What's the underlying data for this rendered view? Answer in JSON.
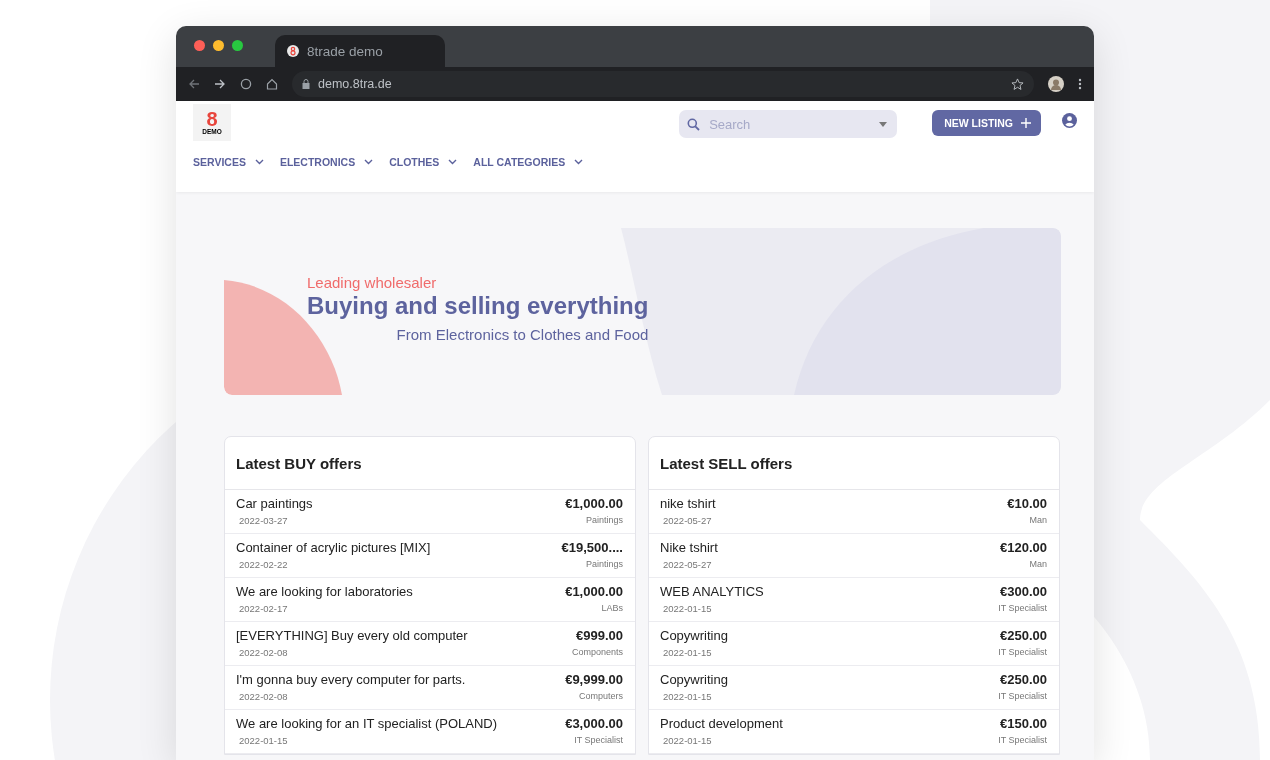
{
  "browser": {
    "tab_title": "8trade demo",
    "url": "demo.8tra.de"
  },
  "header": {
    "logo_mark": "8",
    "logo_text": "DEMO",
    "search": {
      "placeholder": "Search"
    },
    "new_listing_button": "NEW LISTING",
    "nav": [
      {
        "label": "SERVICES"
      },
      {
        "label": "ELECTRONICS"
      },
      {
        "label": "CLOTHES"
      },
      {
        "label": "ALL CATEGORIES"
      }
    ]
  },
  "hero": {
    "eyebrow": "Leading wholesaler",
    "title": "Buying and selling everything",
    "subtitle": "From Electronics to Clothes and Food"
  },
  "panels": [
    {
      "title": "Latest BUY offers",
      "rows": [
        {
          "name": "Car paintings",
          "date": "2022-03-27",
          "price": "€1,000.00",
          "category": "Paintings"
        },
        {
          "name": "Container of acrylic pictures [MIX]",
          "date": "2022-02-22",
          "price": "€19,500....",
          "category": "Paintings"
        },
        {
          "name": "We are looking for laboratories",
          "date": "2022-02-17",
          "price": "€1,000.00",
          "category": "LABs"
        },
        {
          "name": "[EVERYTHING] Buy every old computer",
          "date": "2022-02-08",
          "price": "€999.00",
          "category": "Components"
        },
        {
          "name": "I'm gonna buy every computer for parts.",
          "date": "2022-02-08",
          "price": "€9,999.00",
          "category": "Computers"
        },
        {
          "name": "We are looking for an IT specialist (POLAND)",
          "date": "2022-01-15",
          "price": "€3,000.00",
          "category": "IT Specialist"
        }
      ]
    },
    {
      "title": "Latest SELL offers",
      "rows": [
        {
          "name": "nike tshirt",
          "date": "2022-05-27",
          "price": "€10.00",
          "category": "Man"
        },
        {
          "name": "Nike tshirt",
          "date": "2022-05-27",
          "price": "€120.00",
          "category": "Man"
        },
        {
          "name": "WEB ANALYTICS",
          "date": "2022-01-15",
          "price": "€300.00",
          "category": "IT Specialist"
        },
        {
          "name": "Copywriting",
          "date": "2022-01-15",
          "price": "€250.00",
          "category": "IT Specialist"
        },
        {
          "name": "Copywriting",
          "date": "2022-01-15",
          "price": "€250.00",
          "category": "IT Specialist"
        },
        {
          "name": "Product development",
          "date": "2022-01-15",
          "price": "€150.00",
          "category": "IT Specialist"
        }
      ]
    }
  ]
}
